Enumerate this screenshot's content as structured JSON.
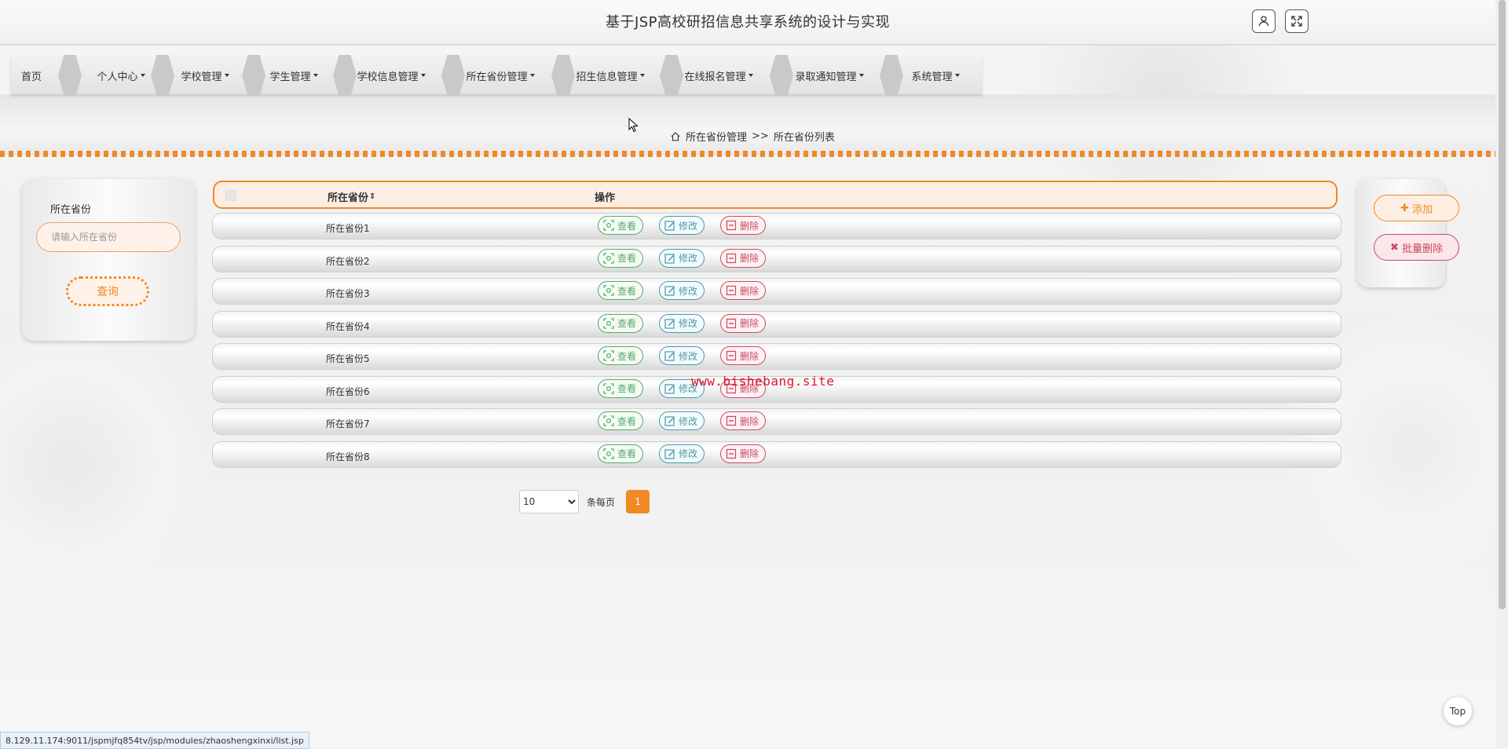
{
  "header": {
    "title": "基于JSP高校研招信息共享系统的设计与实现"
  },
  "nav": {
    "items": [
      {
        "label": "首页",
        "dropdown": false
      },
      {
        "label": "个人中心",
        "dropdown": true
      },
      {
        "label": "学校管理",
        "dropdown": true
      },
      {
        "label": "学生管理",
        "dropdown": true
      },
      {
        "label": "学校信息管理",
        "dropdown": true
      },
      {
        "label": "所在省份管理",
        "dropdown": true
      },
      {
        "label": "招生信息管理",
        "dropdown": true
      },
      {
        "label": "在线报名管理",
        "dropdown": true
      },
      {
        "label": "录取通知管理",
        "dropdown": true
      },
      {
        "label": "系统管理",
        "dropdown": true
      }
    ]
  },
  "breadcrumb": {
    "section": "所在省份管理",
    "separator": ">>",
    "page": "所在省份列表"
  },
  "search": {
    "label": "所在省份",
    "placeholder": "请输入所在省份",
    "button": "查询"
  },
  "table": {
    "headers": {
      "name": "所在省份",
      "sort_icon": "⇕",
      "actions": "操作"
    },
    "actions": {
      "view": "查看",
      "edit": "修改",
      "delete": "删除"
    },
    "rows": [
      "所在省份1",
      "所在省份2",
      "所在省份3",
      "所在省份4",
      "所在省份5",
      "所在省份6",
      "所在省份7",
      "所在省份8"
    ]
  },
  "pager": {
    "page_size": "10",
    "page_size_options": [
      "10"
    ],
    "per_page_label": "条每页",
    "current_page": "1"
  },
  "side": {
    "add": "添加",
    "batch_delete": "批量删除"
  },
  "watermark": "www.bishebang.site",
  "back_to_top": "Top",
  "status_url": "8.129.11.174:9011/jspmjfq854tv/jsp/modules/zhaoshengxinxi/list.jsp",
  "colors": {
    "accent": "#f08a24",
    "view": "#59a86a",
    "edit": "#4a9aa8",
    "delete": "#c94a5e"
  }
}
